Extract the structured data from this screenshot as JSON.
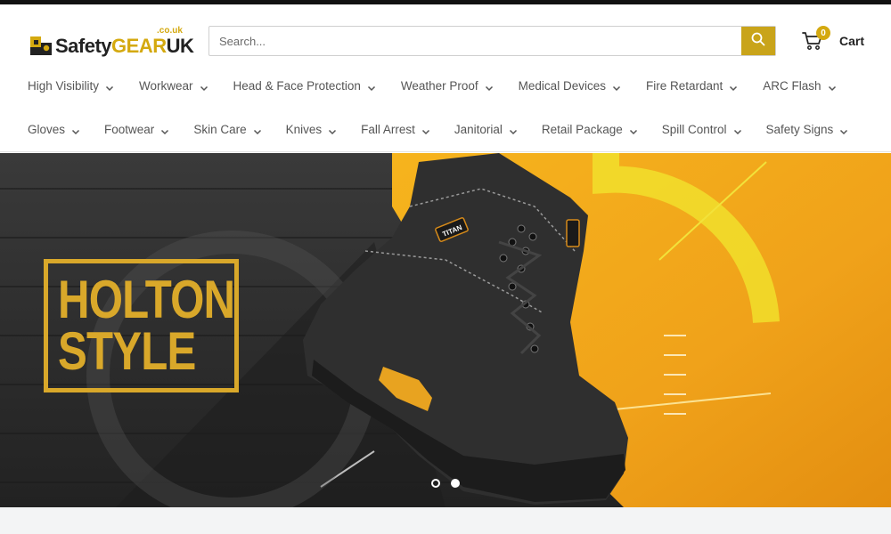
{
  "brand": {
    "logo_text_safety": "Safety",
    "logo_text_gear": "GEAR",
    "logo_text_uk": "UK",
    "logo_couk": ".co.uk",
    "accent_color": "#d4a90f"
  },
  "search": {
    "placeholder": "Search...",
    "value": "",
    "button_icon": "search-icon"
  },
  "cart": {
    "label": "Cart",
    "count": "0",
    "icon": "cart-icon"
  },
  "nav": {
    "row1": [
      {
        "label": "High Visibility"
      },
      {
        "label": "Workwear"
      },
      {
        "label": "Head & Face Protection"
      },
      {
        "label": "Weather Proof"
      },
      {
        "label": "Medical Devices"
      },
      {
        "label": "Fire Retardant"
      },
      {
        "label": "ARC Flash"
      }
    ],
    "row2": [
      {
        "label": "Gloves"
      },
      {
        "label": "Footwear"
      },
      {
        "label": "Skin Care"
      },
      {
        "label": "Knives"
      },
      {
        "label": "Fall Arrest"
      },
      {
        "label": "Janitorial"
      },
      {
        "label": "Retail Package"
      },
      {
        "label": "Spill Control"
      },
      {
        "label": "Safety Signs"
      }
    ]
  },
  "hero": {
    "headline_line1": "HOLTON",
    "headline_line2": "STYLE",
    "boot_brand": "TITAN",
    "slides": 2,
    "active_slide": 1
  }
}
